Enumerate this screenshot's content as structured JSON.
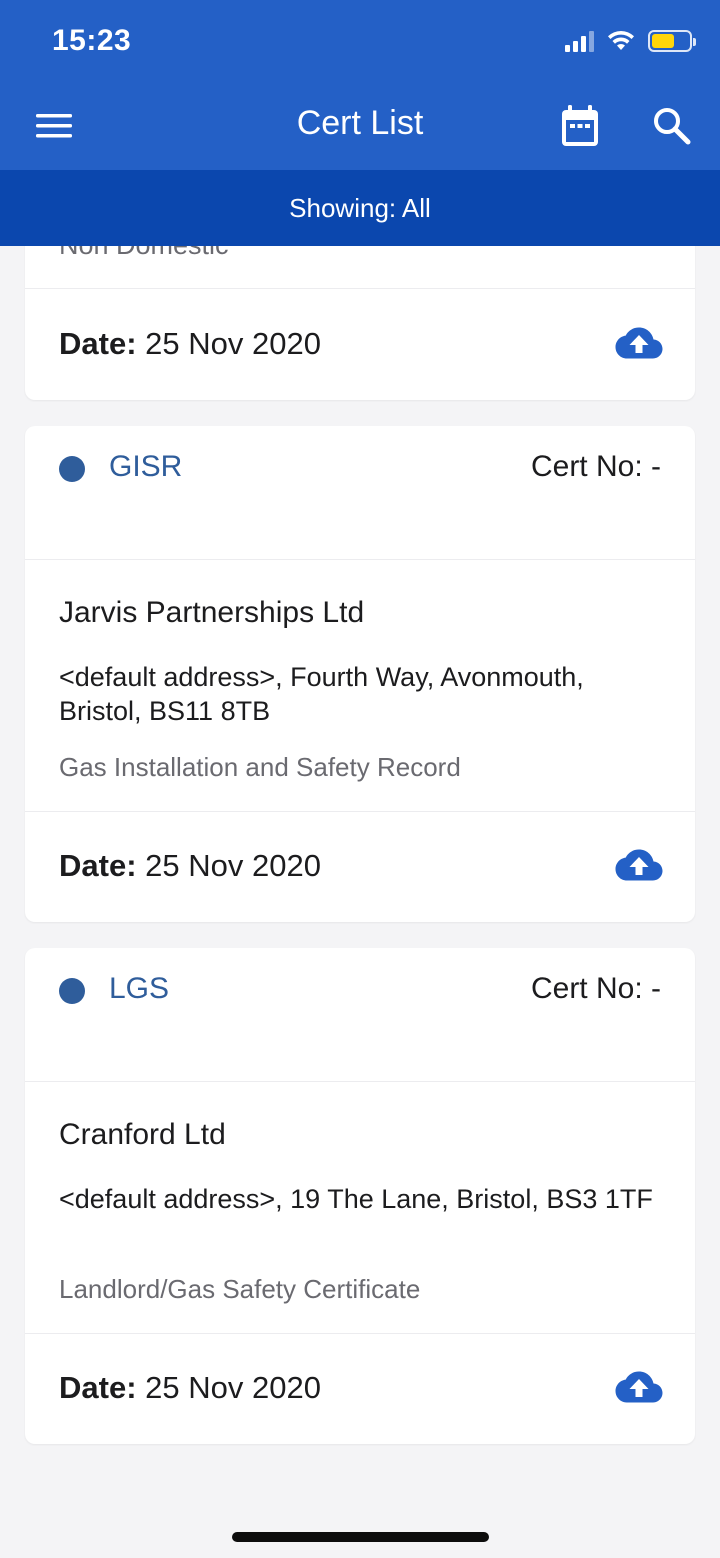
{
  "status_bar": {
    "time": "15:23"
  },
  "header": {
    "title": "Cert List"
  },
  "filter": {
    "label": "Showing: All"
  },
  "colors": {
    "header_bg": "#2460c6",
    "filter_bg": "#0b47ae",
    "accent": "#2f5d9b",
    "upload_icon": "#2460c6"
  },
  "icons": {
    "menu": "hamburger-menu-icon",
    "calendar": "calendar-icon",
    "search": "search-icon",
    "upload": "cloud-upload-icon"
  },
  "cards": [
    {
      "partial_text": "Non Domestic",
      "date_label": "Date:",
      "date_value": "25 Nov 2020"
    },
    {
      "type": "GISR",
      "cert_no": "Cert No: -",
      "client": "Jarvis Partnerships Ltd",
      "address": "<default address>, Fourth Way, Avonmouth, Bristol, BS11 8TB",
      "description": "Gas Installation and Safety Record",
      "date_label": "Date:",
      "date_value": "25 Nov 2020"
    },
    {
      "type": "LGS",
      "cert_no": "Cert No: -",
      "client": "Cranford Ltd",
      "address": "<default address>, 19 The Lane, Bristol, BS3 1TF",
      "description": "Landlord/Gas Safety Certificate",
      "date_label": "Date:",
      "date_value": "25 Nov 2020"
    }
  ]
}
